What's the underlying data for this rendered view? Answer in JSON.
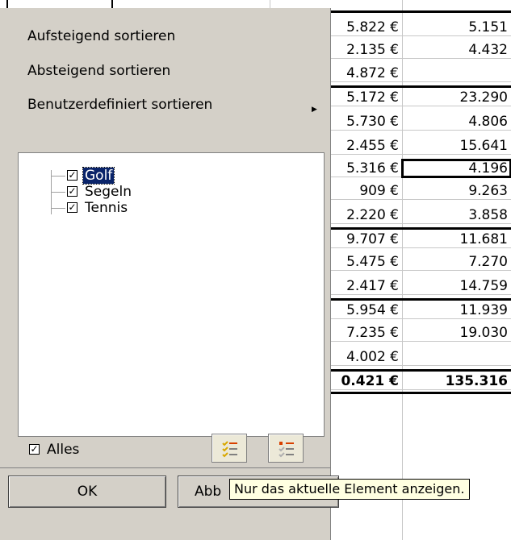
{
  "menu": {
    "sort_ascending": "Aufsteigend sortieren",
    "sort_descending": "Absteigend sortieren",
    "sort_custom": "Benutzerdefiniert sortieren"
  },
  "filter_items": [
    {
      "label": "Golf",
      "checked": true,
      "focused": true
    },
    {
      "label": "Segeln",
      "checked": true
    },
    {
      "label": "Tennis",
      "checked": true
    }
  ],
  "select_all": {
    "label": "Alles",
    "checked": true
  },
  "buttons": {
    "ok": "OK",
    "cancel_partial": "Abb"
  },
  "tooltip": "Nur das aktuelle Element anzeigen.",
  "icons": {
    "show_all": "show-all-icon",
    "show_current": "show-current-only-icon",
    "submenu": "submenu-arrow-icon"
  },
  "spreadsheet": {
    "rows": [
      {
        "c1": "5.822 €",
        "c2": "5.151"
      },
      {
        "c1": "2.135 €",
        "c2": "4.432"
      },
      {
        "c1": "4.872 €",
        "c2": ""
      },
      {
        "c1": "5.172 €",
        "c2": "23.290"
      },
      {
        "c1": "5.730 €",
        "c2": "4.806"
      },
      {
        "c1": "2.455 €",
        "c2": "15.641"
      },
      {
        "c1": "5.316 €",
        "c2": "4.196"
      },
      {
        "c1": "909 €",
        "c2": "9.263"
      },
      {
        "c1": "2.220 €",
        "c2": "3.858"
      },
      {
        "c1": "9.707 €",
        "c2": "11.681"
      },
      {
        "c1": "5.475 €",
        "c2": "7.270"
      },
      {
        "c1": "2.417 €",
        "c2": "14.759"
      },
      {
        "c1": "5.954 €",
        "c2": "11.939"
      },
      {
        "c1": "7.235 €",
        "c2": "19.030"
      },
      {
        "c1": "4.002 €",
        "c2": ""
      },
      {
        "c1": "0.421 €",
        "c2": "135.316"
      }
    ]
  }
}
